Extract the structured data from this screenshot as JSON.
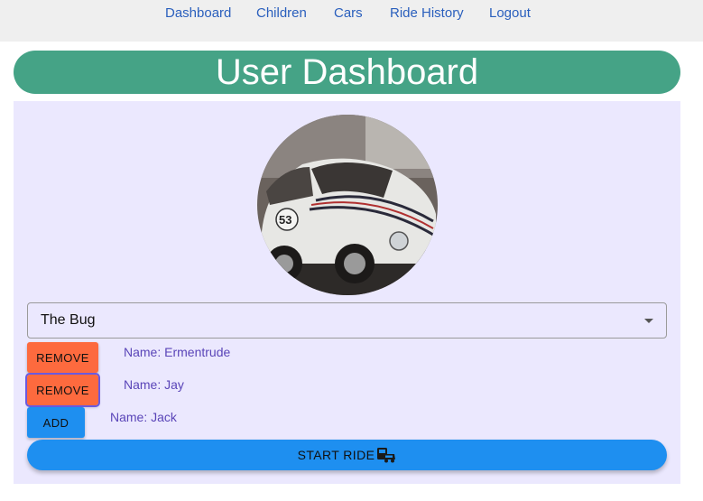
{
  "nav": {
    "links": [
      "Dashboard",
      "Children",
      "Cars",
      "Ride History",
      "Logout"
    ]
  },
  "header": {
    "title": "User Dashboard"
  },
  "car_select": {
    "value": "The Bug",
    "icon": "chevron-down-icon"
  },
  "children": [
    {
      "action": "REMOVE",
      "name": "Name: Ermentrude"
    },
    {
      "action": "REMOVE",
      "name": "Name: Jay"
    },
    {
      "action": "ADD",
      "name": "Name: Jack"
    }
  ],
  "start_ride": {
    "label": "START RIDE",
    "icon": "car-ride-icon"
  },
  "colors": {
    "header": "#45a386",
    "panel": "#ebe8fe",
    "remove": "#fd6a3e",
    "add": "#1e8ff0",
    "name_text": "#5a45b8",
    "nav_link": "#2a5fbd"
  }
}
